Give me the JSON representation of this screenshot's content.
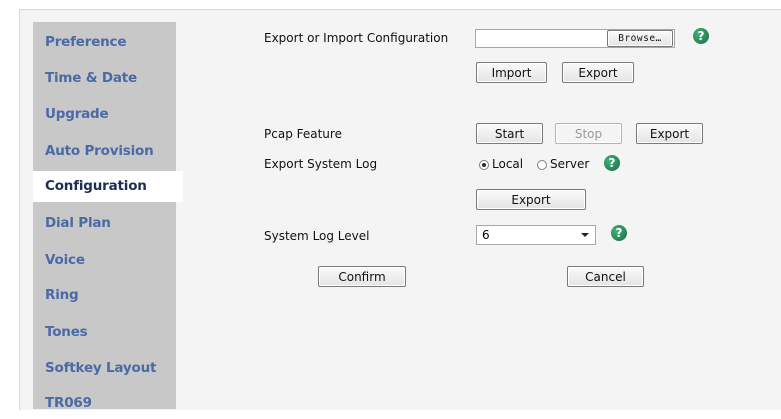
{
  "sidebar": {
    "items": [
      {
        "label": "Preference"
      },
      {
        "label": "Time & Date"
      },
      {
        "label": "Upgrade"
      },
      {
        "label": "Auto Provision"
      },
      {
        "label": "Configuration"
      },
      {
        "label": "Dial Plan"
      },
      {
        "label": "Voice"
      },
      {
        "label": "Ring"
      },
      {
        "label": "Tones"
      },
      {
        "label": "Softkey Layout"
      },
      {
        "label": "TR069"
      }
    ],
    "active": "Configuration"
  },
  "config": {
    "export_import_label": "Export or Import Configuration",
    "file_value": "",
    "browse_label": "Browse…",
    "import_label": "Import",
    "export_label": "Export"
  },
  "pcap": {
    "label": "Pcap Feature",
    "start_label": "Start",
    "stop_label": "Stop",
    "export_label": "Export"
  },
  "syslog": {
    "label": "Export System Log",
    "local_label": "Local",
    "server_label": "Server",
    "selected": "Local",
    "export_label": "Export"
  },
  "log_level": {
    "label": "System Log Level",
    "value": "6"
  },
  "footer": {
    "confirm_label": "Confirm",
    "cancel_label": "Cancel"
  },
  "help_icon": "?",
  "colors": {
    "nav_text": "#4a6aa6",
    "nav_active_text": "#1b2f55",
    "sidebar_bg": "#c8c8c8",
    "help_green": "#2e8b57"
  }
}
